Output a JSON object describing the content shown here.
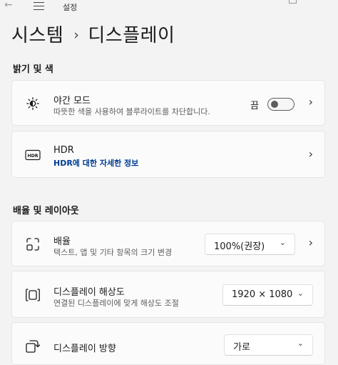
{
  "window": {
    "back_icon": "back-arrow-icon",
    "menu_icon": "hamburger-icon",
    "app_title": "설정"
  },
  "breadcrumb": {
    "parent": "시스템",
    "separator": "›",
    "current": "디스플레이"
  },
  "sections": {
    "brightness": {
      "header": "밝기 및 색",
      "night_light": {
        "icon": "night-light-icon",
        "title": "야간 모드",
        "subtitle": "따뜻한 색을 사용하여 블루라이트를 차단합니다.",
        "toggle_label": "끔",
        "toggle_on": false,
        "chevron": "›"
      },
      "hdr": {
        "icon": "hdr-icon",
        "icon_text": "HDR",
        "title": "HDR",
        "link": "HDR에 대한 자세한 정보",
        "chevron": "›"
      }
    },
    "scale_layout": {
      "header": "배율 및 레이아웃",
      "scale": {
        "icon": "scale-icon",
        "title": "배율",
        "subtitle": "텍스트, 앱 및 기타 항목의 크기 변경",
        "value": "100%(권장)",
        "caret": "⌄",
        "chevron": "›"
      },
      "resolution": {
        "icon": "resolution-icon",
        "title": "디스플레이 해상도",
        "subtitle": "연결된 디스플레이에 맞게 해상도 조절",
        "value": "1920 × 1080",
        "caret": "⌄"
      },
      "orientation": {
        "icon": "orientation-icon",
        "title": "디스플레이 방향",
        "value": "가로",
        "caret": "⌄"
      }
    }
  }
}
